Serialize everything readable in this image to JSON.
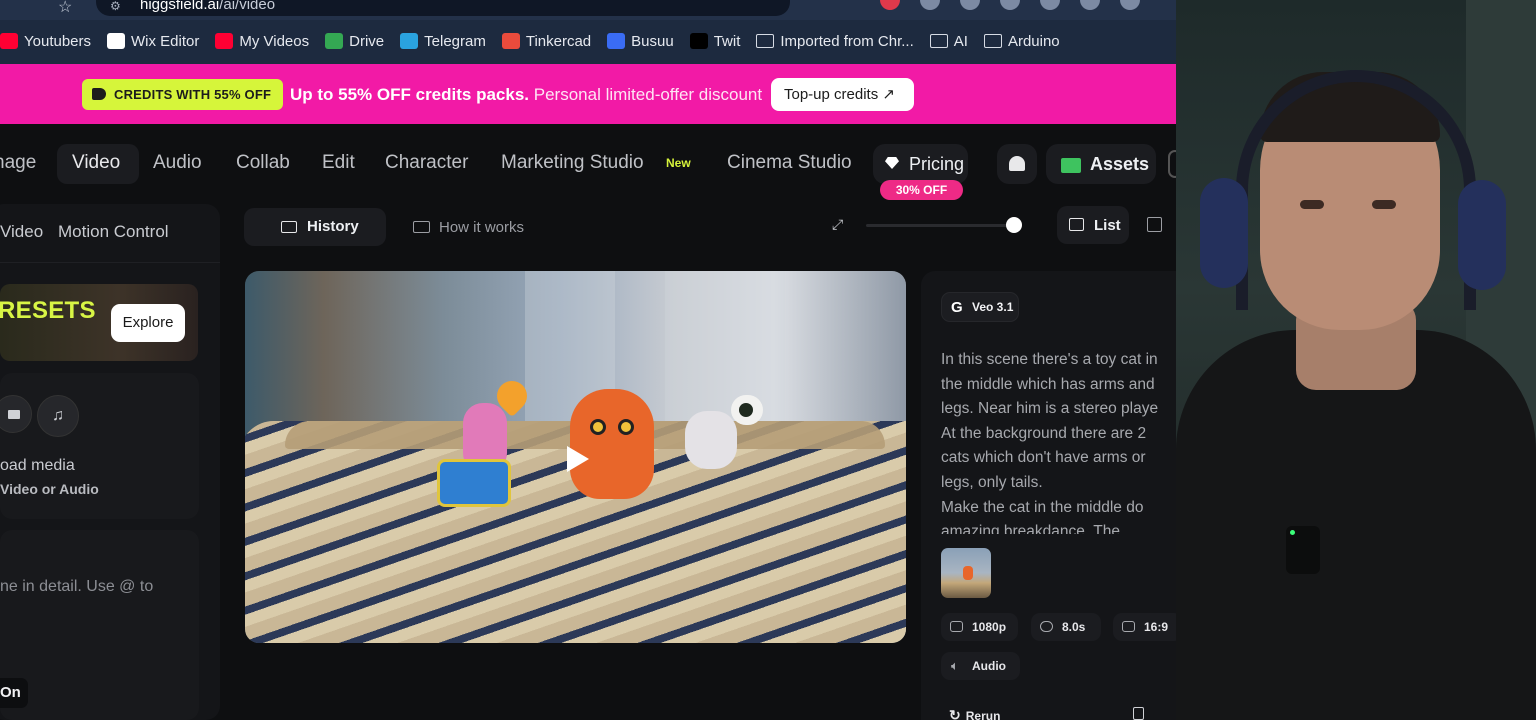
{
  "browser": {
    "url_host": "higgsfield.ai",
    "url_path": "/ai/video",
    "bookmarks": [
      {
        "label": "Youtubers",
        "icon": "youtube-icon",
        "color": "#ff0033"
      },
      {
        "label": "Wix Editor",
        "icon": "wix-icon",
        "color": "#ffffff"
      },
      {
        "label": "My Videos",
        "icon": "youtube-icon",
        "color": "#ff0033"
      },
      {
        "label": "Drive",
        "icon": "drive-icon",
        "color": "#34a853"
      },
      {
        "label": "Telegram",
        "icon": "telegram-icon",
        "color": "#2aa3e0"
      },
      {
        "label": "Tinkercad",
        "icon": "tinkercad-icon",
        "color": "#e94b3c"
      },
      {
        "label": "Busuu",
        "icon": "busuu-icon",
        "color": "#3a6cf4"
      },
      {
        "label": "Twit",
        "icon": "x-icon",
        "color": "#000000"
      },
      {
        "label": "Imported from Chr...",
        "icon": "folder-icon",
        "color": ""
      },
      {
        "label": "AI",
        "icon": "folder-icon",
        "color": ""
      },
      {
        "label": "Arduino",
        "icon": "folder-icon",
        "color": ""
      }
    ]
  },
  "promo": {
    "tag": "CREDITS WITH 55% OFF",
    "headline": "Up to 55% OFF credits packs.",
    "subtext": "Personal limited-offer discount",
    "button": "Top-up credits ↗",
    "bg_color": "#f21aa6",
    "tag_color": "#d6f53a"
  },
  "nav": {
    "items": [
      "nage",
      "Video",
      "Audio",
      "Collab",
      "Edit",
      "Character",
      "Marketing Studio",
      "Cinema Studio"
    ],
    "new_badge": "New",
    "pricing": "Pricing",
    "pricing_badge": "30% OFF",
    "assets": "Assets"
  },
  "left_panel": {
    "tabs": [
      "Video",
      "Motion Control"
    ],
    "presets_text": "RESETS",
    "explore": "Explore",
    "upload_title": "oad media",
    "upload_sub": "Video or Audio",
    "prompt_placeholder": "ne in detail. Use @ to",
    "toggle_label": "On"
  },
  "toolbar": {
    "history": "History",
    "how_it_works": "How it works",
    "list": "List"
  },
  "details": {
    "model": "Veo 3.1",
    "description_lines": [
      "In this scene there's a toy cat in",
      "the middle which has arms and",
      "legs. Near him is a stereo playe",
      "At the background there are 2",
      "cats which don't have arms or",
      "legs, only tails.",
      "Make the cat in the middle do",
      "amazing breakdance. The"
    ],
    "resolution": "1080p",
    "duration": "8.0s",
    "aspect": "16:9",
    "audio": "Audio",
    "rerun": "Rerun"
  }
}
